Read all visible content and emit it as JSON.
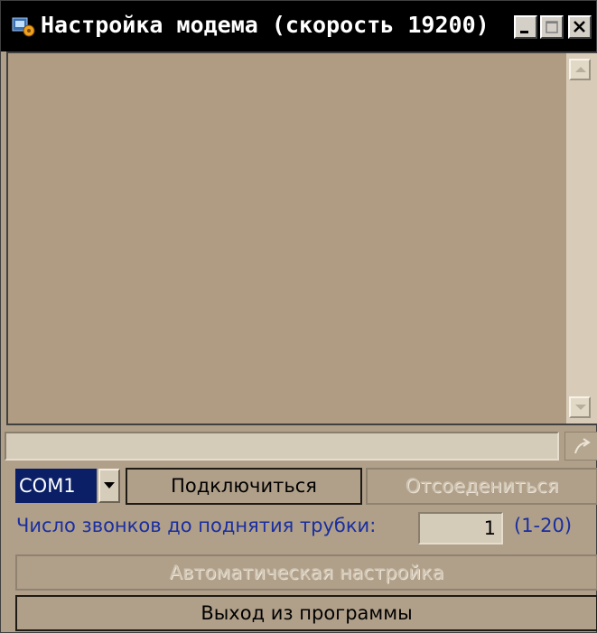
{
  "window": {
    "title": "Настройка модема (скорость 19200)",
    "icons": {
      "app": "modem-app-icon",
      "minimize": "minimize-icon",
      "maximize": "maximize-icon",
      "close": "close-icon"
    }
  },
  "log": {
    "text": ""
  },
  "command": {
    "value": "",
    "send_icon": "send-arrow-icon"
  },
  "port": {
    "selected": "COM1",
    "dropdown_icon": "chevron-down-icon"
  },
  "buttons": {
    "connect": "Подключиться",
    "disconnect": "Отсоедениться",
    "autoconfig": "Автоматическая настройка",
    "exit": "Выход из программы"
  },
  "rings": {
    "label": "Число звонков до поднятия трубки:",
    "value": "1",
    "range": "(1-20)"
  },
  "colors": {
    "panel": "#b0a08a",
    "title_bg": "#000000",
    "label_blue": "#1a2ea0",
    "selected_bg": "#0a1f66"
  }
}
